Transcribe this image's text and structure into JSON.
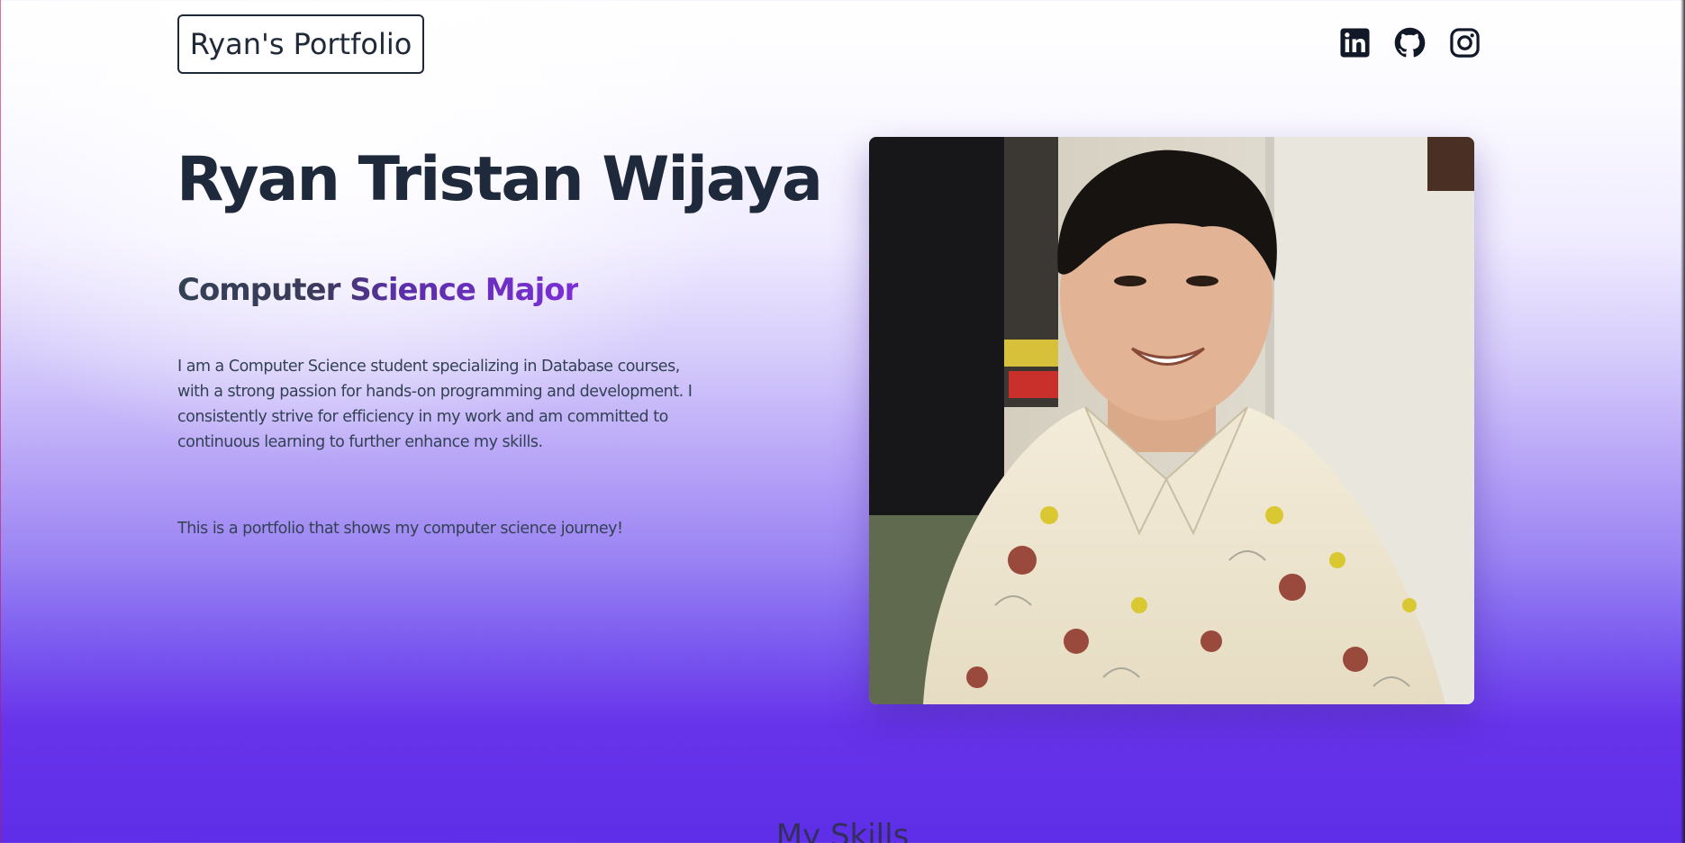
{
  "navbar": {
    "brand": "Ryan's Portfolio",
    "social_links": [
      {
        "icon": "linkedin-icon",
        "label": "LinkedIn"
      },
      {
        "icon": "github-icon",
        "label": "GitHub"
      },
      {
        "icon": "instagram-icon",
        "label": "Instagram"
      }
    ]
  },
  "hero": {
    "name": "Ryan Tristan Wijaya",
    "subtitle": "Computer Science Major",
    "description": "I am a Computer Science student specializing in Database courses, with a strong passion for hands-on programming and development. I consistently strive for efficiency in my work and am committed to continuous learning to further enhance my skills.",
    "note": "This is a portfolio that shows my computer science journey!"
  },
  "sections": {
    "skills_heading": "My Skills"
  },
  "colors": {
    "text_dark": "#1e293b",
    "accent_purple": "#7c2fd6",
    "background_bottom": "#5e2ee8"
  }
}
